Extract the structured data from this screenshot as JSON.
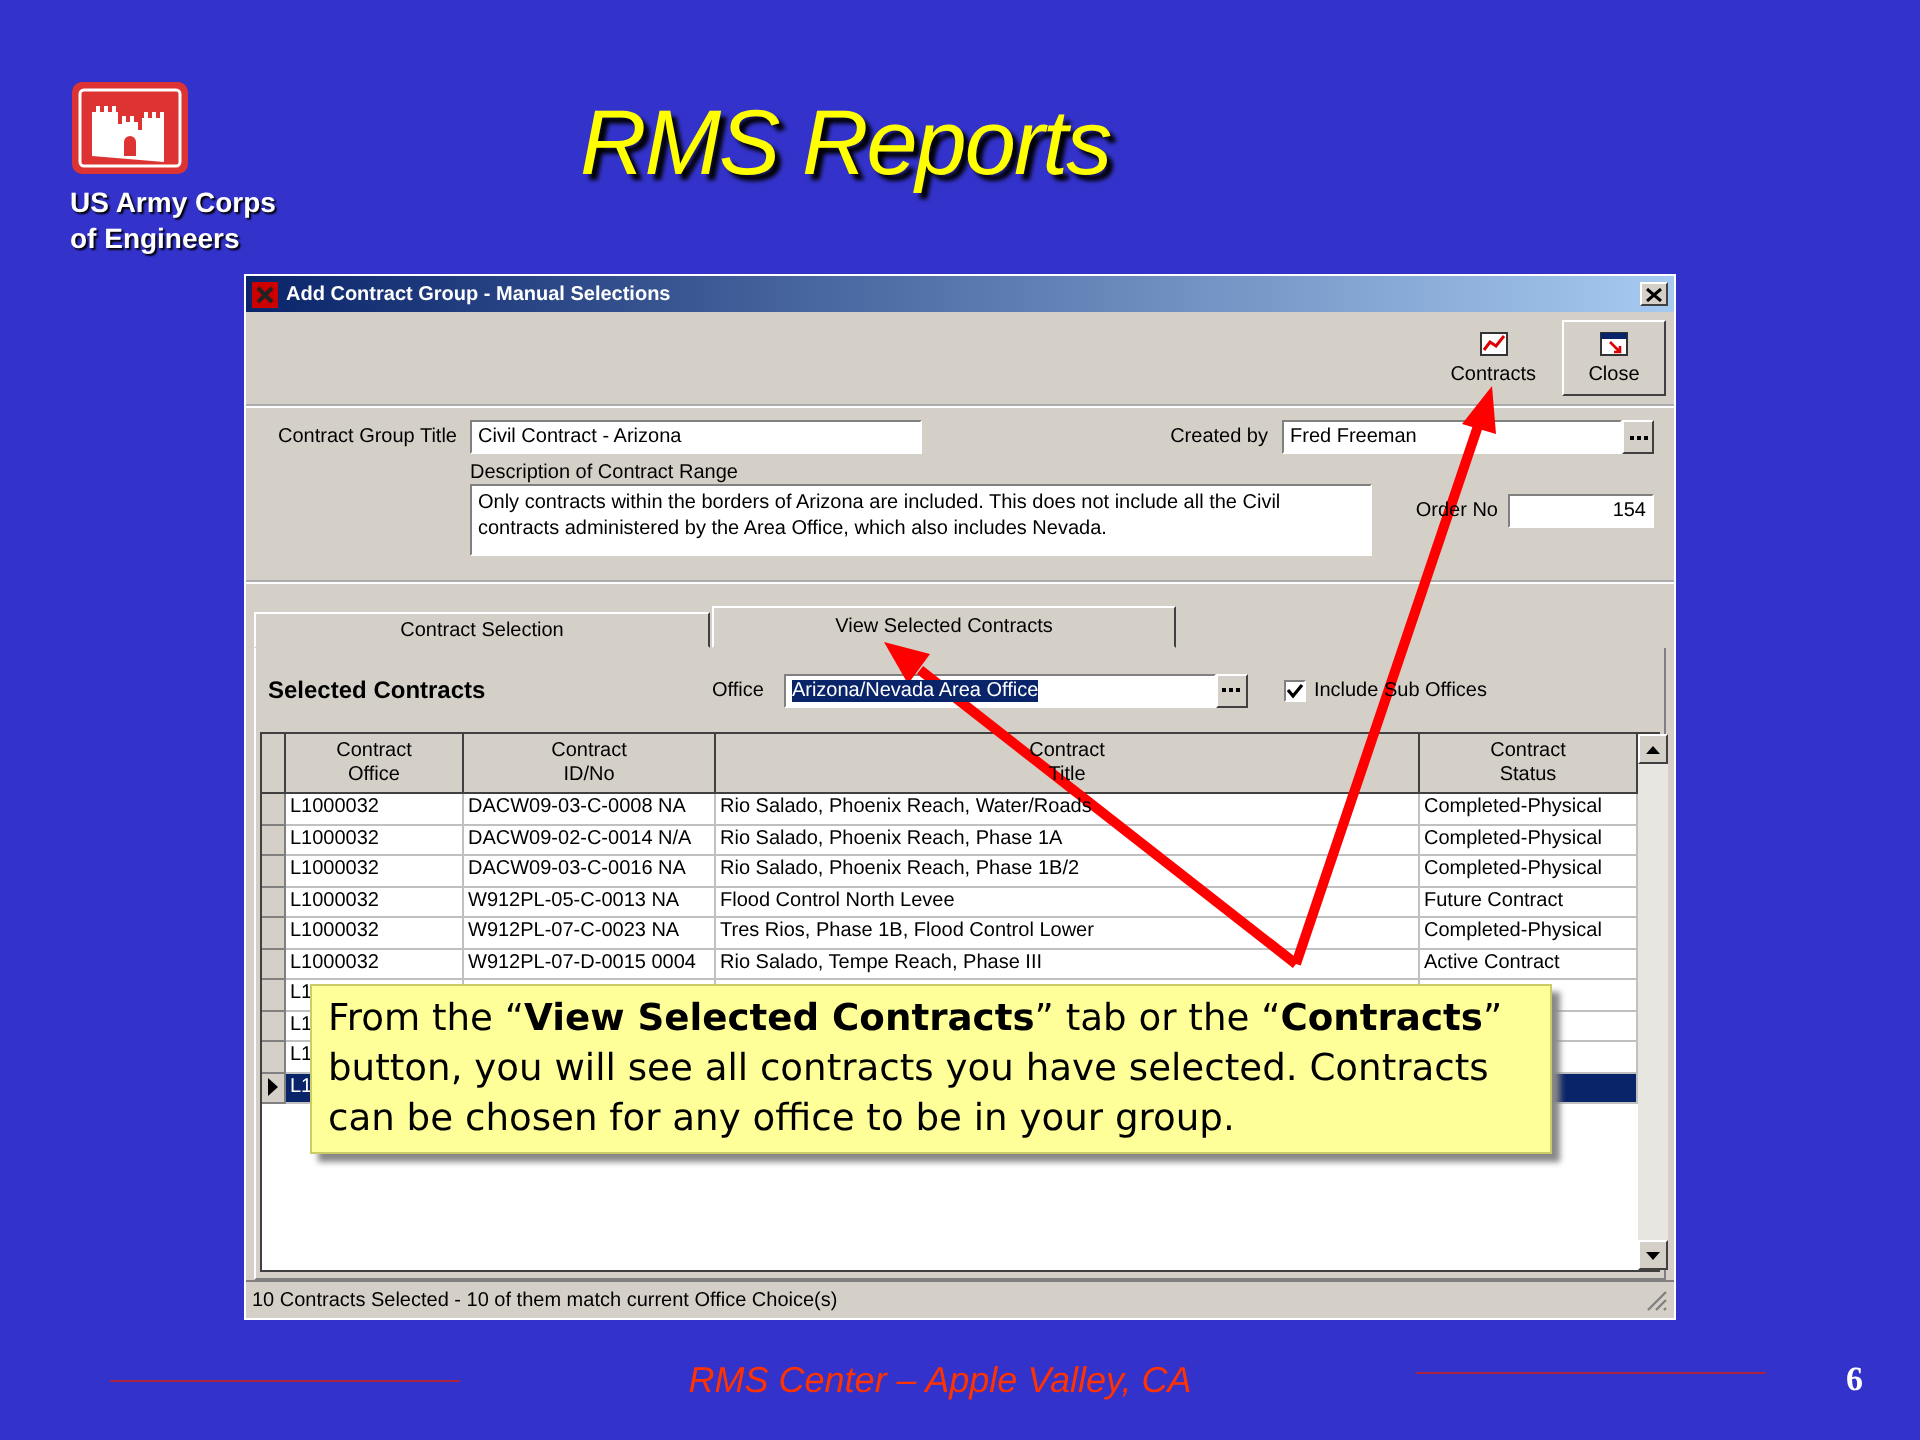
{
  "slide": {
    "logo_text": "US Army Corps of Engineers",
    "title": "RMS Reports",
    "footer": "RMS Center – Apple Valley, CA",
    "page_number": "6"
  },
  "window": {
    "title": "Add Contract Group - Manual Selections",
    "toolbar": [
      {
        "label": "Contracts",
        "kind": "flat"
      },
      {
        "label": "Close",
        "kind": "raised"
      }
    ],
    "form": {
      "group_title_label": "Contract Group Title",
      "group_title": "Civil Contract - Arizona",
      "created_by_label": "Created by",
      "created_by": "Fred Freeman",
      "description_label": "Description of Contract Range",
      "description": "Only contracts within the borders of Arizona are included. This does not include all the Civil contracts administered by the Area Office, which also includes Nevada.",
      "order_no_label": "Order No",
      "order_no": "154"
    },
    "tabs": [
      {
        "label": "Contract Selection",
        "selected": false
      },
      {
        "label": "View Selected Contracts",
        "selected": true
      }
    ],
    "panel": {
      "heading": "Selected Contracts",
      "office_label": "Office",
      "office": "Arizona/Nevada Area Office",
      "include_sub_offices": {
        "label": "Include Sub Offices",
        "checked": true
      }
    },
    "table": {
      "columns": [
        "Contract\nOffice",
        "Contract\nID/No",
        "Contract\nTitle",
        "Contract\nStatus"
      ],
      "rows": [
        {
          "cells": [
            "L1000032",
            "DACW09-03-C-0008 NA",
            "Rio Salado, Phoenix Reach, Water/Roads",
            "Completed-Physical"
          ],
          "selected": false
        },
        {
          "cells": [
            "L1000032",
            "DACW09-02-C-0014 N/A",
            "Rio Salado, Phoenix Reach, Phase 1A",
            "Completed-Physical"
          ],
          "selected": false
        },
        {
          "cells": [
            "L1000032",
            "DACW09-03-C-0016 NA",
            "Rio Salado, Phoenix Reach, Phase 1B/2",
            "Completed-Physical"
          ],
          "selected": false
        },
        {
          "cells": [
            "L1000032",
            "W912PL-05-C-0013 NA",
            "Flood Control North Levee",
            "Future Contract"
          ],
          "selected": false
        },
        {
          "cells": [
            "L1000032",
            "W912PL-07-C-0023 NA",
            "Tres Rios, Phase 1B, Flood Control Lower",
            "Completed-Physical"
          ],
          "selected": false
        },
        {
          "cells": [
            "L1000032",
            "W912PL-07-D-0015 0004",
            "Rio Salado, Tempe Reach, Phase III",
            "Active Contract"
          ],
          "selected": false
        },
        {
          "cells": [
            "L1"
          ],
          "selected": false
        },
        {
          "cells": [
            "L1"
          ],
          "selected": false
        },
        {
          "cells": [
            "L1"
          ],
          "selected": false
        },
        {
          "cells": [
            "L1"
          ],
          "selected": true
        }
      ]
    },
    "status_bar": "10 Contracts Selected - 10 of them match current Office Choice(s)"
  },
  "callout": "From the “**View Selected Contracts**” tab or the “**Contracts**” button, you will see all contracts you have selected. Contracts can be chosen for any office to be in your group."
}
